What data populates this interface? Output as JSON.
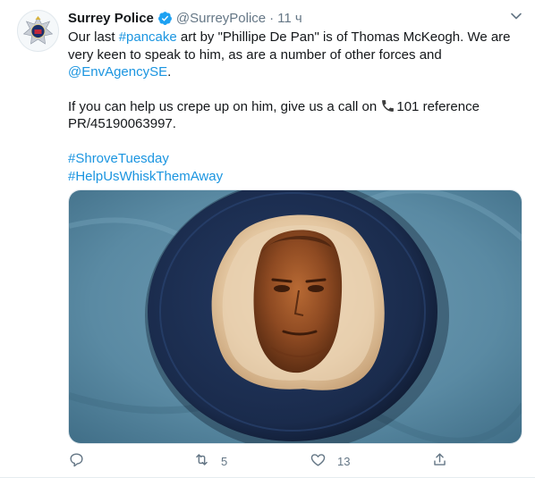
{
  "tweet": {
    "author": "Surrey Police",
    "handle": "@SurreyPolice",
    "separator": "·",
    "time": "11 ч",
    "line1_pre": "Our last ",
    "hashtag_pancake": "#pancake",
    "line1_post": " art by \"Phillipe De Pan\" is of Thomas McKeogh. We are very keen to speak to him, as are a number of other forces and ",
    "mention": "@EnvAgencySE",
    "mention_post": ".",
    "line2_pre": "If you can help us crepe up on him, give us a call on ",
    "line2_post": "101 reference PR/45190063997.",
    "hashtag1": "#ShroveTuesday",
    "hashtag2": "#HelpUsWhiskThemAway"
  },
  "actions": {
    "retweets": "5",
    "likes": "13"
  },
  "colors": {
    "link": "#1b95e0",
    "muted": "#657786",
    "verified": "#1da1f2",
    "plate": "#1c2b4a",
    "tablecloth": "#5f8fa8"
  },
  "icons": [
    "verified-icon",
    "chevron-down-icon",
    "phone-icon",
    "reply-icon",
    "retweet-icon",
    "like-icon",
    "share-icon"
  ]
}
